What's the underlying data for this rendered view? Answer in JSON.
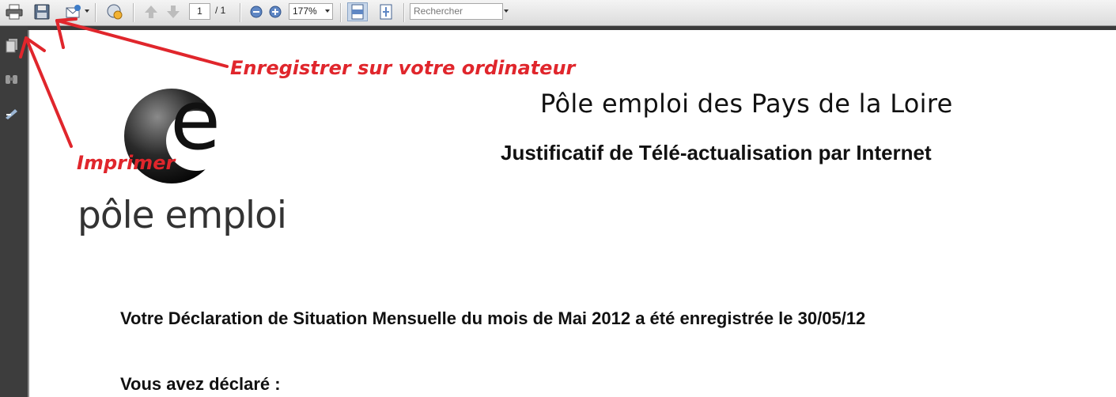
{
  "toolbar": {
    "icons": [
      "print-icon",
      "save-icon",
      "email-icon",
      "review-icon",
      "previous-page-icon",
      "next-page-icon",
      "zoom-out-icon",
      "zoom-in-icon",
      "fit-width-icon",
      "fit-page-icon"
    ],
    "page_current": "1",
    "page_total": "/ 1",
    "zoom": "177%",
    "search_placeholder": "Rechercher"
  },
  "sidebar": {
    "icons": [
      "pages-icon",
      "attachments-icon",
      "signatures-icon"
    ]
  },
  "document": {
    "title": "Pôle emploi des Pays de la Loire",
    "subtitle": "Justificatif de Télé-actualisation par Internet",
    "logo_text": "pôle emploi",
    "logo_letter": "e",
    "declaration": "Votre Déclaration de Situation Mensuelle du mois  de Mai 2012 a été enregistrée le 30/05/12",
    "declared": "Vous avez déclaré :"
  },
  "annotations": {
    "save": "Enregistrer sur votre ordinateur",
    "print": "Imprimer",
    "color": "#e0262c"
  }
}
